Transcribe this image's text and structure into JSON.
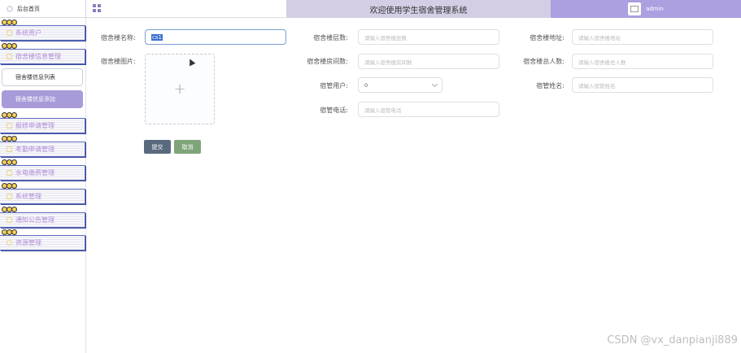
{
  "header": {
    "home_label": "后台首页",
    "title": "欢迎使用学生宿舍管理系统",
    "username": "admin"
  },
  "sidebar": {
    "items": [
      {
        "label": "系统用户"
      },
      {
        "label": "宿舍楼信息管理"
      },
      {
        "label": "报修申请管理"
      },
      {
        "label": "考勤申请管理"
      },
      {
        "label": "水电缴费管理"
      },
      {
        "label": "系统管理"
      },
      {
        "label": "通知公告管理"
      },
      {
        "label": "资源管理"
      }
    ],
    "subitems": [
      {
        "label": "宿舍楼信息列表"
      },
      {
        "label": "宿舍楼信息添加"
      }
    ]
  },
  "form": {
    "name_label": "宿舍楼名称:",
    "name_value": "cs1",
    "image_label": "宿舍楼图片:",
    "floors_label": "宿舍楼层数:",
    "floors_placeholder": "请输入宿舍楼层数",
    "address_label": "宿舍楼地址:",
    "address_placeholder": "请输入宿舍楼地址",
    "rooms_label": "宿舍楼房间数:",
    "rooms_placeholder": "请输入宿舍楼房间数",
    "total_label": "宿舍楼总人数:",
    "total_placeholder": "请输入宿舍楼总人数",
    "manager_user_label": "宿管用户:",
    "manager_user_value": "0",
    "manager_name_label": "宿管姓名:",
    "manager_name_placeholder": "请输入宿管姓名",
    "manager_phone_label": "宿管电话:",
    "manager_phone_placeholder": "请输入宿管电话",
    "upload_plus": "+",
    "submit_label": "提交",
    "cancel_label": "取消"
  },
  "watermark": "CSDN @vx_danpianji889",
  "colors": {
    "title_bar": "#d3cee4",
    "user_bar": "#ad9fe0",
    "active_sub": "#a99ad9",
    "submit": "#5a6a7e",
    "cancel": "#7fa47a",
    "menu_text": "#b08cd6"
  }
}
